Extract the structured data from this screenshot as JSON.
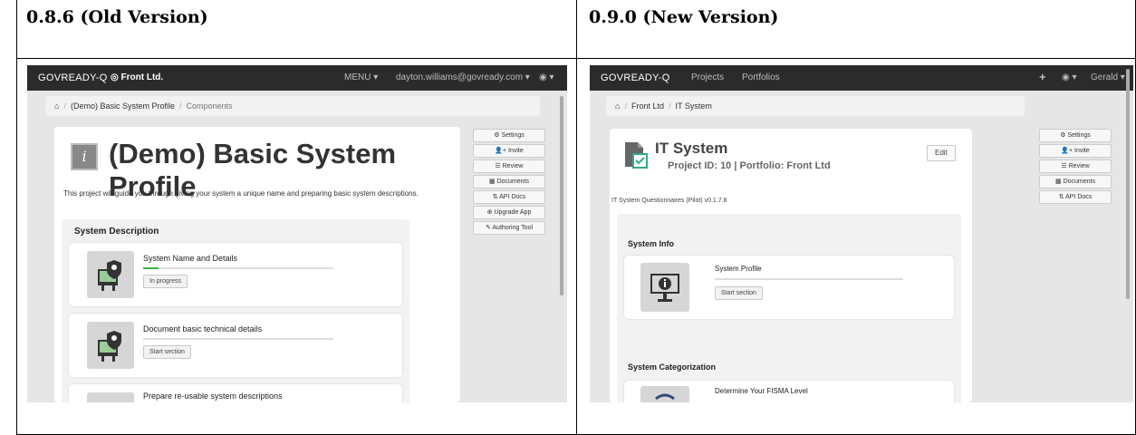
{
  "headers": {
    "old": "0.8.6 (Old Version)",
    "new": "0.9.0 (New Version)"
  },
  "old": {
    "brand": "GOVREADY-Q",
    "org": "Front Ltd.",
    "menu": "MENU ▾",
    "user": "dayton.williams@govready.com ▾",
    "breadcrumb": {
      "project": "(Demo) Basic System Profile",
      "current": "Components"
    },
    "title": "(Demo) Basic System Profile",
    "description": "This project will guide you through giving your system a unique name and preparing basic system descriptions.",
    "section_title": "System Description",
    "tasks": [
      {
        "label": "System Name and Details",
        "button": "In progress",
        "progress": 0.08
      },
      {
        "label": "Document basic technical details",
        "button": "Start section",
        "progress": 0
      },
      {
        "label": "Prepare re-usable system descriptions"
      }
    ],
    "side_buttons": [
      "⚙ Settings",
      "👤+ Invite",
      "☰ Review",
      "▦ Documents",
      "⇅ API Docs",
      "⊕ Upgrade App",
      "✎ Authoring Tool"
    ]
  },
  "new": {
    "brand": "GOVREADY-Q",
    "nav": [
      "Projects",
      "Portfolios"
    ],
    "plus": "+",
    "user": "Gerald ▾",
    "breadcrumb": {
      "org": "Front Ltd",
      "current": "IT System"
    },
    "title": "IT System",
    "subtitle": "Project ID: 10 | Portfolio: Front Ltd",
    "edit": "Edit",
    "questionnaire": "IT System Questionnaires (Pilot) v0.1.7.8",
    "section1": "System Info",
    "task1": {
      "label": "System Profile",
      "button": "Start section"
    },
    "section2": "System Categorization",
    "task2": {
      "label": "Determine Your FISMA Level"
    },
    "side_buttons": [
      "⚙ Settings",
      "👤+ Invite",
      "☰ Review",
      "▦ Documents",
      "⇅ API Docs"
    ]
  }
}
